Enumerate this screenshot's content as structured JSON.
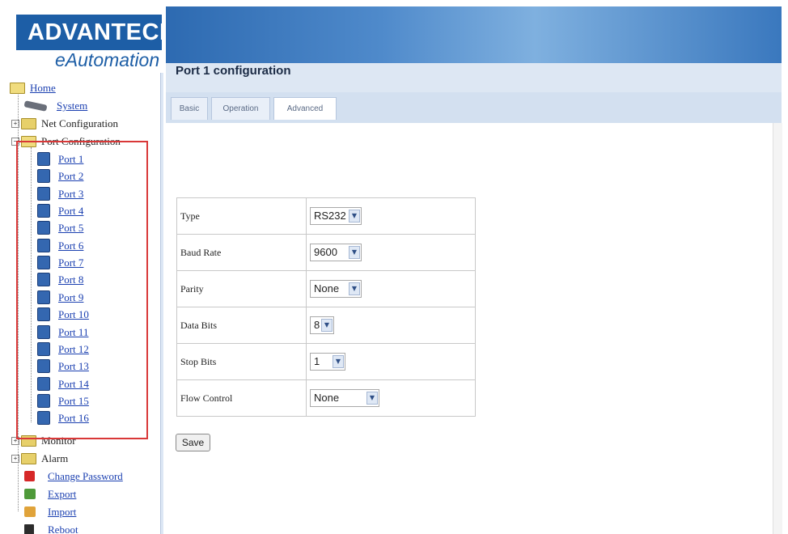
{
  "brand": {
    "logo_text": "ADVANTECH",
    "subtitle": "eAutomation"
  },
  "tree": {
    "home": "Home",
    "system": "System",
    "net_configuration": "Net Configuration",
    "port_configuration": "Port Configuration",
    "ports": [
      "Port 1",
      "Port 2",
      "Port 3",
      "Port 4",
      "Port 5",
      "Port 6",
      "Port 7",
      "Port 8",
      "Port 9",
      "Port 10",
      "Port 11",
      "Port 12",
      "Port 13",
      "Port 14",
      "Port 15",
      "Port 16"
    ],
    "monitor": "Monitor",
    "alarm": "Alarm",
    "change_password": "Change Password",
    "export": "Export",
    "import": "Import",
    "reboot": "Reboot"
  },
  "main": {
    "title": "Port 1 configuration",
    "tabs": [
      {
        "label": "Basic",
        "active": false
      },
      {
        "label": "Operation",
        "active": false
      },
      {
        "label": "Advanced",
        "active": true
      }
    ],
    "fields": [
      {
        "label": "Type",
        "value": "RS232"
      },
      {
        "label": "Baud Rate",
        "value": "9600"
      },
      {
        "label": "Parity",
        "value": "None"
      },
      {
        "label": "Data Bits",
        "value": "8"
      },
      {
        "label": "Stop Bits",
        "value": "1"
      },
      {
        "label": "Flow Control",
        "value": "None"
      }
    ],
    "save_label": "Save"
  },
  "colors": {
    "brand_blue": "#1d5ea6",
    "link_blue": "#1a3fb0",
    "highlight_red": "#d93838",
    "panel_bg": "#dde7f3"
  }
}
